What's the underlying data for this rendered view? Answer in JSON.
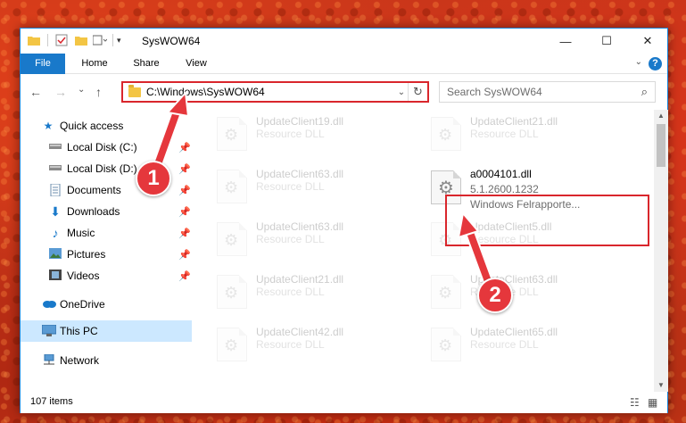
{
  "window": {
    "title": "SysWOW64",
    "controls": {
      "minimize": "—",
      "maximize": "☐",
      "close": "✕"
    }
  },
  "ribbon": {
    "tabs": [
      "File",
      "Home",
      "Share",
      "View"
    ],
    "help": "?"
  },
  "navigation": {
    "back": "←",
    "forward": "→",
    "recent": "⌄",
    "up": "↑",
    "address": "C:\\Windows\\SysWOW64",
    "search_placeholder": "Search SysWOW64"
  },
  "sidebar": {
    "items": [
      {
        "label": "Quick access",
        "icon": "star-icon",
        "pinned": false
      },
      {
        "label": "Local Disk (C:)",
        "icon": "drive-icon",
        "pinned": true
      },
      {
        "label": "Local Disk (D:)",
        "icon": "drive-icon",
        "pinned": true
      },
      {
        "label": "Documents",
        "icon": "documents-icon",
        "pinned": true
      },
      {
        "label": "Downloads",
        "icon": "download-icon",
        "pinned": true
      },
      {
        "label": "Music",
        "icon": "music-icon",
        "pinned": true
      },
      {
        "label": "Pictures",
        "icon": "pictures-icon",
        "pinned": true
      },
      {
        "label": "Videos",
        "icon": "videos-icon",
        "pinned": true
      },
      {
        "label": "OneDrive",
        "icon": "cloud-icon",
        "pinned": false
      },
      {
        "label": "This PC",
        "icon": "computer-icon",
        "pinned": false,
        "selected": true
      },
      {
        "label": "Network",
        "icon": "network-icon",
        "pinned": false
      }
    ]
  },
  "files": {
    "left_column": [
      {
        "name": "UpdateClient19.dll",
        "type": "Resource DLL"
      },
      {
        "name": "UpdateClient63.dll",
        "type": "Resource DLL"
      },
      {
        "name": "UpdateClient63.dll",
        "type": "Resource DLL"
      },
      {
        "name": "UpdateClient21.dll",
        "type": "Resource DLL"
      },
      {
        "name": "UpdateClient42.dll",
        "type": "Resource DLL"
      }
    ],
    "right_column": [
      {
        "name": "UpdateClient21.dll",
        "type": "Resource DLL"
      },
      {
        "name": "UpdateClient5.dll",
        "type": "Resource DLL"
      },
      {
        "name": "UpdateClient63.dll",
        "type": "Resource DLL"
      },
      {
        "name": "UpdateClient65.dll",
        "type": "Resource DLL"
      }
    ],
    "highlighted": {
      "name": "a0004101.dll",
      "version": "5.1.2600.1232",
      "description": "Windows Felrapporte..."
    }
  },
  "status": {
    "item_count": "107 items"
  },
  "annotations": {
    "step1": "1",
    "step2": "2",
    "color": "#e5373c"
  },
  "colors": {
    "accent": "#1979ca",
    "highlight_border": "#d9262c",
    "selected": "#cce8ff"
  }
}
